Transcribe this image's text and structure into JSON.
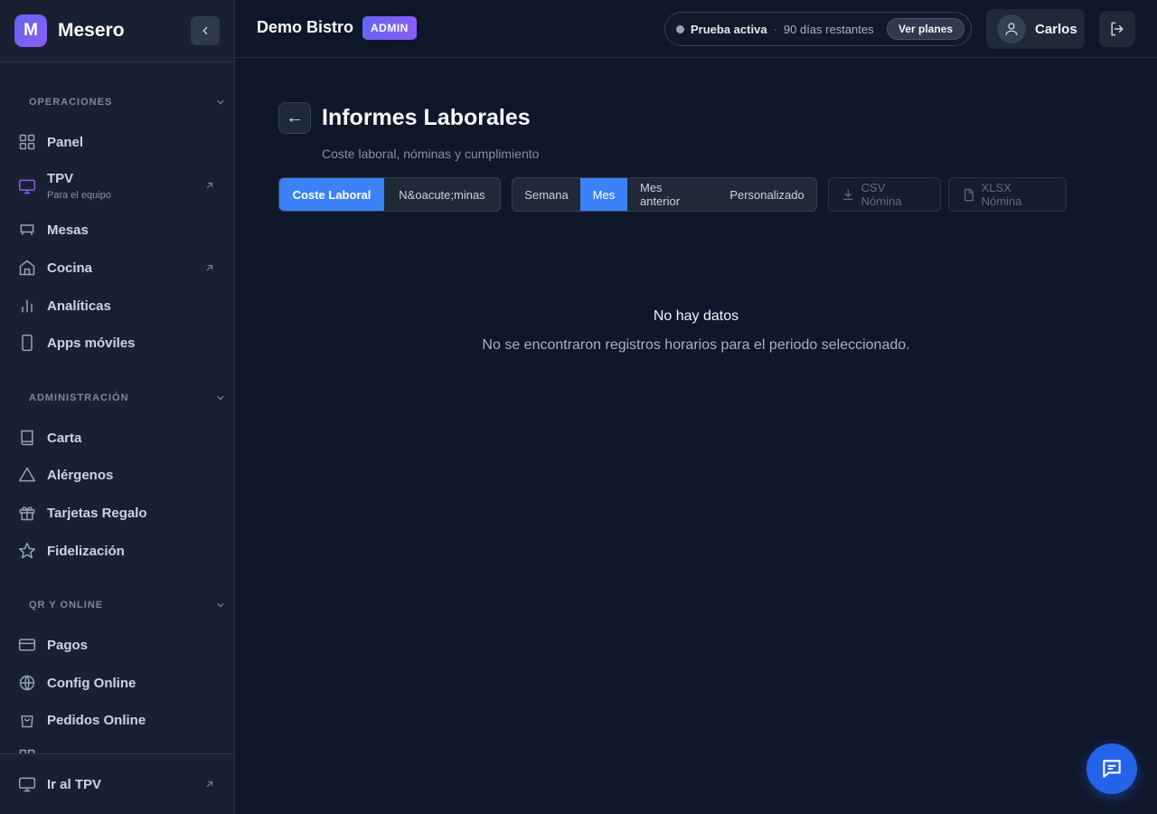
{
  "brand": {
    "logo_letter": "M",
    "name": "Mesero"
  },
  "sidebar": {
    "sections": [
      {
        "title": "OPERACIONES"
      },
      {
        "title": "ADMINISTRACIÓN"
      },
      {
        "title": "QR Y ONLINE"
      }
    ],
    "items": [
      {
        "label": "Panel",
        "icon": "grid-icon"
      },
      {
        "label": "TPV",
        "sub": "Para el equipo",
        "icon": "monitor-icon",
        "external": true
      },
      {
        "label": "Mesas",
        "icon": "tables-icon"
      },
      {
        "label": "Cocina",
        "icon": "home-icon",
        "external": true
      },
      {
        "label": "Analíticas",
        "icon": "bar-chart-icon"
      },
      {
        "label": "Apps móviles",
        "icon": "phone-icon"
      },
      {
        "label": "Carta",
        "icon": "book-icon"
      },
      {
        "label": "Alérgenos",
        "icon": "warning-icon"
      },
      {
        "label": "Tarjetas Regalo",
        "icon": "gift-icon"
      },
      {
        "label": "Fidelización",
        "icon": "star-icon"
      },
      {
        "label": "Pagos",
        "icon": "card-icon"
      },
      {
        "label": "Config Online",
        "icon": "globe-icon"
      },
      {
        "label": "Pedidos Online",
        "icon": "bag-icon"
      }
    ],
    "footer": {
      "label": "Ir al TPV",
      "icon": "monitor-icon"
    }
  },
  "topbar": {
    "org_name": "Demo Bistro",
    "role": "ADMIN",
    "trial_status": "Prueba activa",
    "trial_sep": "·",
    "trial_days": "90 días restantes",
    "plans_label": "Ver planes",
    "user_name": "Carlos"
  },
  "main": {
    "back_label": "←",
    "title": "Informes Laborales",
    "subtitle": "Coste laboral, nóminas y cumplimiento",
    "view_tabs": [
      "Coste Laboral",
      "N&oacute;minas"
    ],
    "active_view": "Coste Laboral",
    "period_tabs": [
      "Semana",
      "Mes",
      "Mes anterior",
      "Personalizado"
    ],
    "active_period": "Mes",
    "export_csv": "CSV Nómina",
    "export_xlsx": "XLSX Nómina",
    "empty_title": "No hay datos",
    "empty_desc": "No se encontraron registros horarios para el periodo seleccionado."
  },
  "colors": {
    "accent": "#3b82f6",
    "brand_gradient_start": "#6366f1",
    "brand_gradient_end": "#8b5cf6",
    "background": "#0f172a",
    "sidebar": "#182131"
  }
}
